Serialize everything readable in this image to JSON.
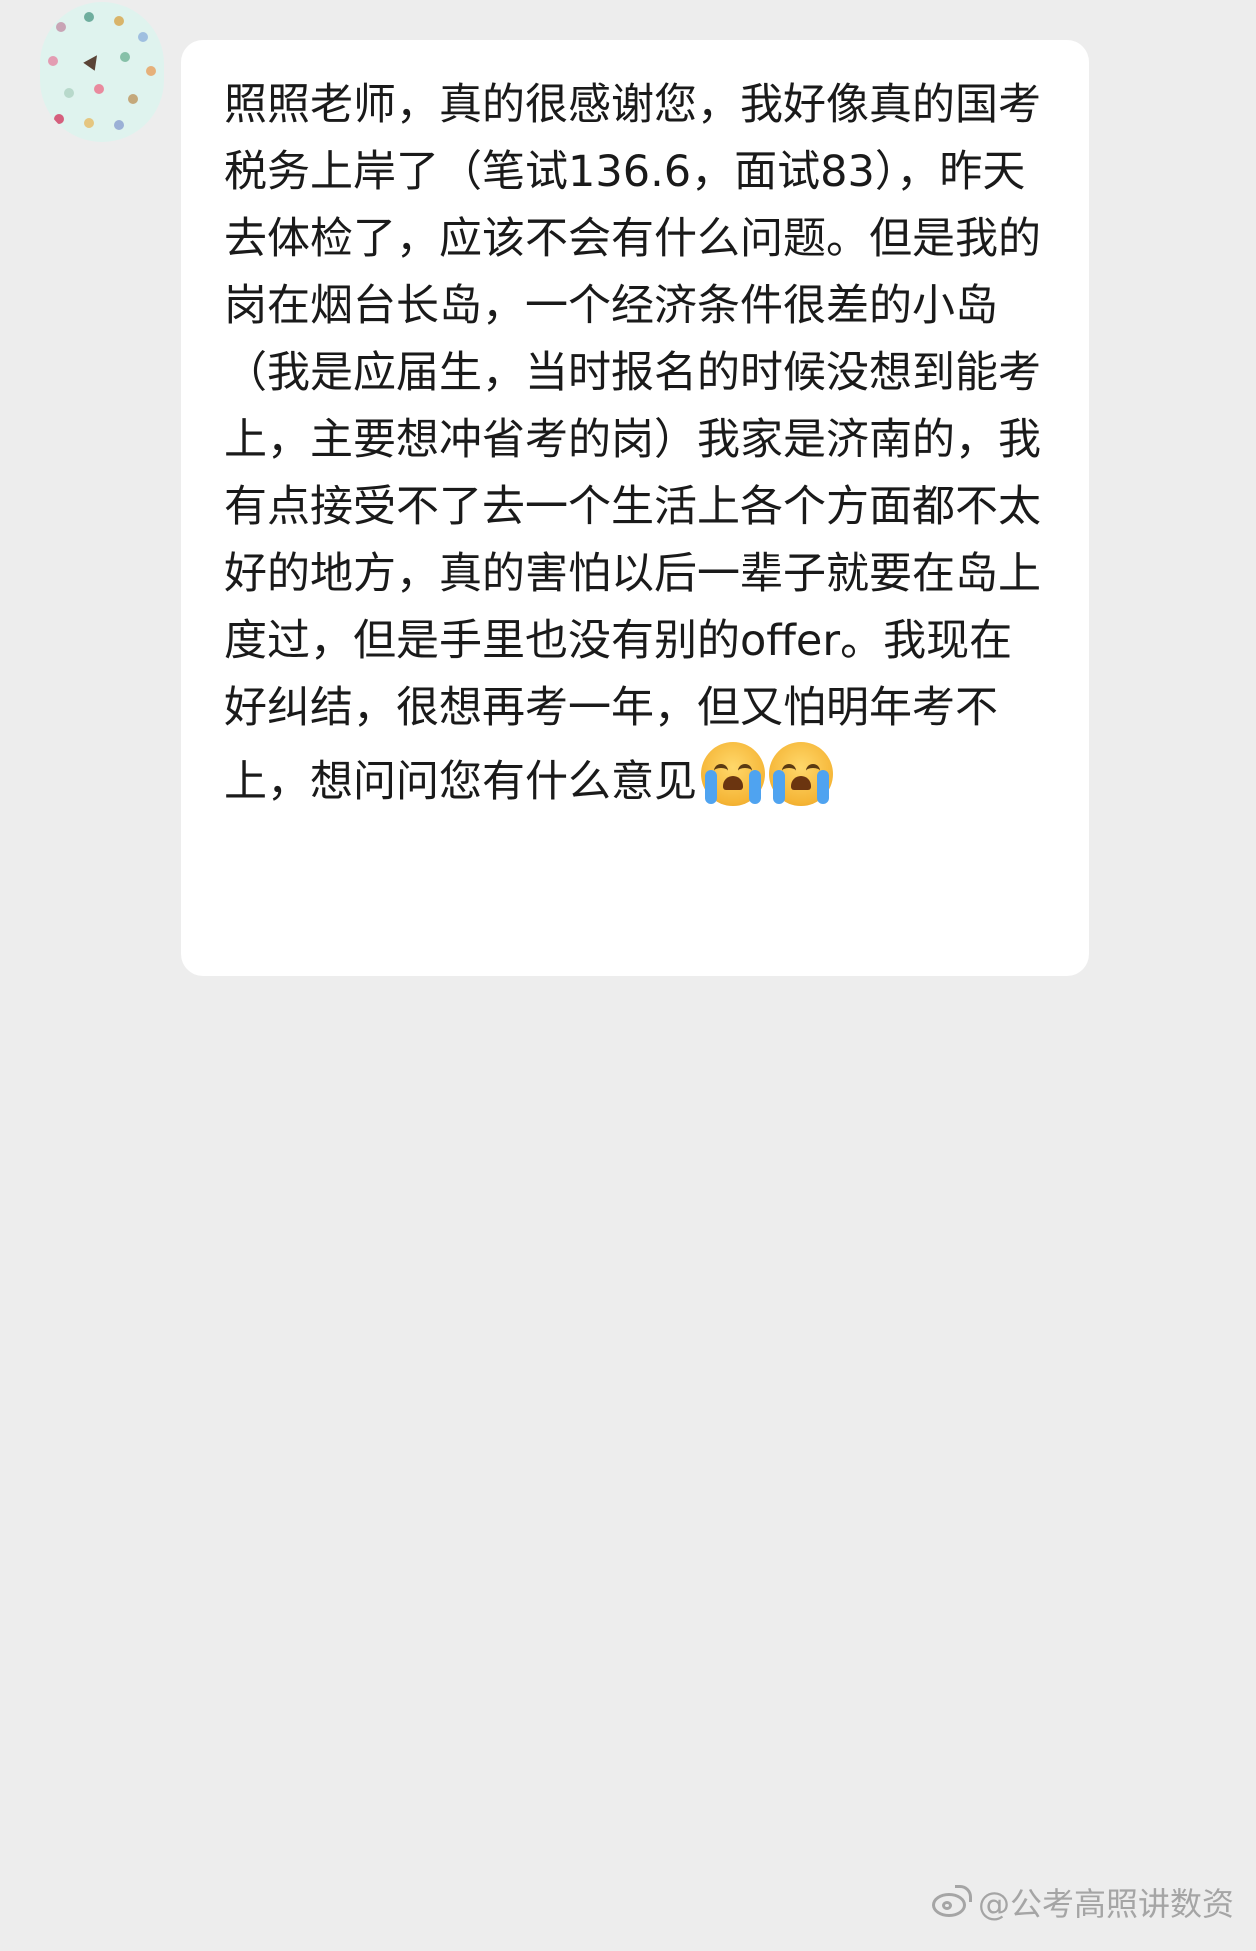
{
  "chat": {
    "message": {
      "text": "照照老师，真的很感谢您，我好像真的国考税务上岸了（笔试136.6，面试83），昨天去体检了，应该不会有什么问题。但是我的岗在烟台长岛，一个经济条件很差的小岛（我是应届生，当时报名的时候没想到能考上，主要想冲省考的岗）我家是济南的，我有点接受不了去一个生活上各个方面都不太好的地方，真的害怕以后一辈子就要在岛上度过，但是手里也没有别的offer。我现在好纠结，很想再考一年，但又怕明年考不上，想问问您有什么意见",
      "emojis": [
        "loudly-crying-face",
        "loudly-crying-face"
      ]
    },
    "avatar": {
      "icon": "avatar-polka-dot-icon"
    }
  },
  "watermark": {
    "text": "@公考高照讲数资",
    "icon": "weibo-icon"
  },
  "colors": {
    "background": "#ededed",
    "bubble": "#ffffff",
    "text": "#1a1a1a"
  }
}
